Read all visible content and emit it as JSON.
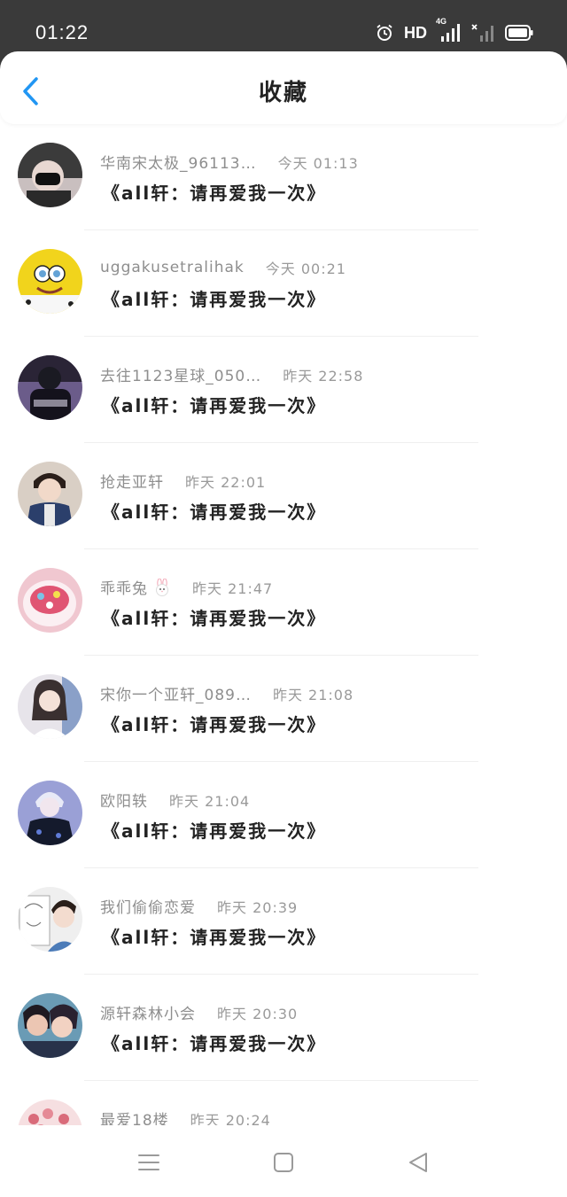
{
  "status": {
    "time": "01:22",
    "hd": "HD",
    "network": "4G"
  },
  "header": {
    "title": "收藏"
  },
  "items": [
    {
      "username": "华南宋太极_96113…",
      "time": "今天 01:13",
      "title": "《all轩：请再爱我一次》",
      "avatar_colors": [
        "#3b3b3b",
        "#c9bfbf"
      ]
    },
    {
      "username": "uggakusetralihak",
      "time": "今天 00:21",
      "title": "《all轩：请再爱我一次》",
      "avatar_colors": [
        "#f1d41c",
        "#64a3d6"
      ]
    },
    {
      "username": "去往1123星球_050…",
      "time": "昨天 22:58",
      "title": "《all轩：请再爱我一次》",
      "avatar_colors": [
        "#2a2436",
        "#6b5c8a"
      ]
    },
    {
      "username": "抢走亚轩",
      "time": "昨天 22:01",
      "title": "《all轩：请再爱我一次》",
      "avatar_colors": [
        "#d9cfc5",
        "#2b3f6b"
      ]
    },
    {
      "username": "乖乖兔",
      "emoji": "rabbit-emoji",
      "time": "昨天 21:47",
      "title": "《all轩：请再爱我一次》",
      "avatar_colors": [
        "#f0c7d0",
        "#e05573"
      ]
    },
    {
      "username": "宋你一个亚轩_089…",
      "time": "昨天 21:08",
      "title": "《all轩：请再爱我一次》",
      "avatar_colors": [
        "#e7e4ea",
        "#3a3030"
      ]
    },
    {
      "username": "欧阳轶",
      "time": "昨天 21:04",
      "title": "《all轩：请再爱我一次》",
      "avatar_colors": [
        "#9aa0d6",
        "#141a2c"
      ]
    },
    {
      "username": "我们偷偷恋爱",
      "time": "昨天 20:39",
      "title": "《all轩：请再爱我一次》",
      "avatar_colors": [
        "#efefef",
        "#4b7bb8"
      ]
    },
    {
      "username": "源轩森林小会",
      "time": "昨天 20:30",
      "title": "《all轩：请再爱我一次》",
      "avatar_colors": [
        "#6a9bb5",
        "#ecc6b3"
      ]
    },
    {
      "username": "最爱18楼",
      "time": "昨天 20:24",
      "title": "",
      "avatar_colors": [
        "#f6dfe1",
        "#d96b7a"
      ]
    }
  ],
  "navbar": {
    "icons": [
      "menu-icon",
      "home-square-icon",
      "back-triangle-icon"
    ]
  },
  "colors": {
    "accent": "#2196f3",
    "statusbar": "#3a3a3a"
  }
}
